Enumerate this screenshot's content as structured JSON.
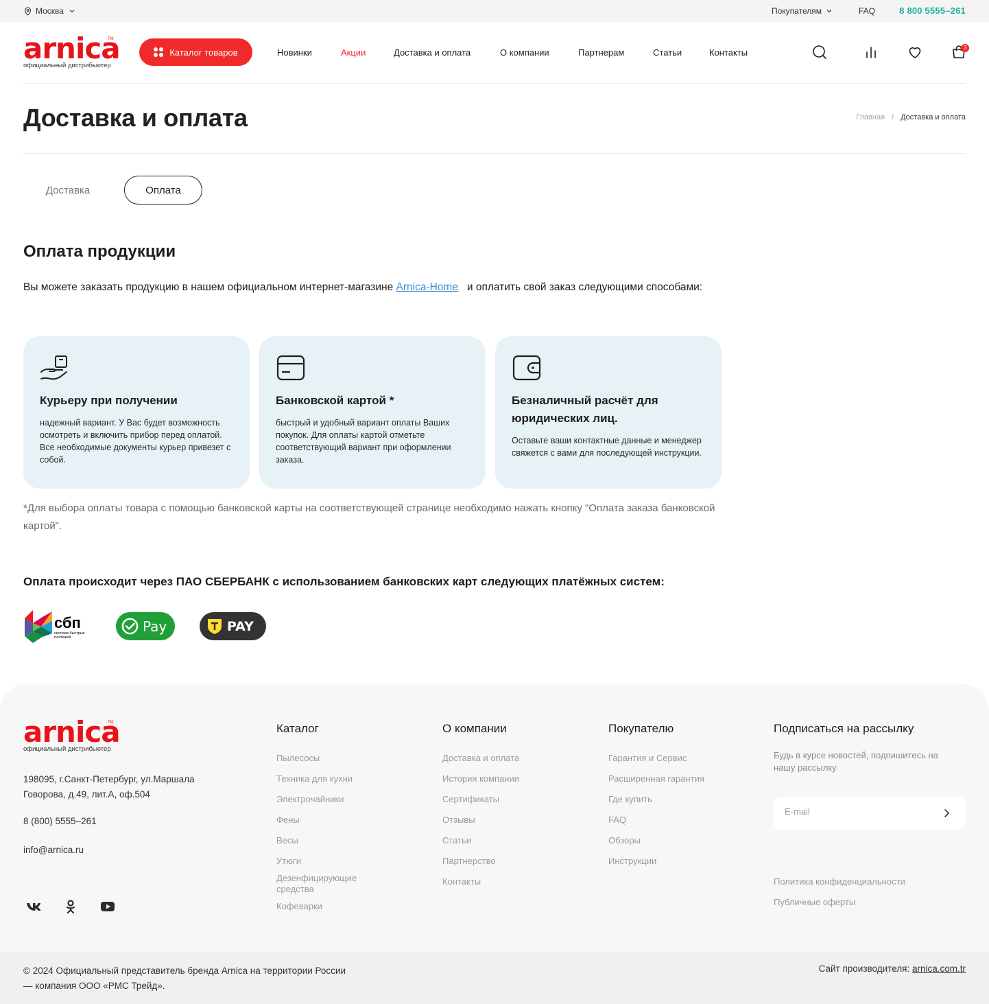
{
  "topbar": {
    "city": "Москва",
    "buyers": "Покупателям",
    "faq": "FAQ",
    "phone": "8 800 5555–261"
  },
  "logo": {
    "word": "arnica",
    "tagline": "официальный дистрибьютер"
  },
  "header": {
    "catalog_button": "Каталог товаров",
    "nav": [
      "Новинки",
      "Акции",
      "Доставка и оплата",
      "О компании",
      "Партнерам",
      "Статьи",
      "Контакты"
    ],
    "cart_count": "3"
  },
  "page": {
    "title": "Доставка и оплата",
    "breadcrumb": {
      "home": "Главная",
      "separator": "/",
      "current": "Доставка и оплата"
    },
    "tabs": {
      "delivery": "Доставка",
      "payment": "Оплата"
    },
    "section_title": "Оплата продукции",
    "intro_before": "Вы можете заказать продукцию в нашем официальном интернет-магазине ",
    "intro_link": "Arnica-Home",
    "intro_after": "   и оплатить свой заказ следующими способами:",
    "cards": [
      {
        "title": "Курьеру при получении",
        "text": "надежный вариант. У Вас будет возможность осмотреть и включить прибор перед оплатой. Все необходимые документы курьер привезет с собой."
      },
      {
        "title": "Банковской картой *",
        "text": "быстрый и удобный вариант оплаты Ваших покупок. Для оплаты картой отметьте соответствующий вариант при оформлении заказа."
      },
      {
        "title": "Безналичный расчёт для юридических лиц.",
        "text": "Оставьте ваши контактные данные и менеджер свяжется с вами для последующей инструкции."
      }
    ],
    "footnote": "*Для выбора оплаты товара с помощью банковской карты на соответствующей странице необходимо нажать кнопку \"Оплата заказа банковской картой\".",
    "sber_text": "Оплата происходит через ПАО СБЕРБАНК с использованием банковских карт следующих платёжных систем:",
    "pay_systems": {
      "sbp": "сбп",
      "sbp_sub": "система быстрых платежей",
      "pay": "Pay",
      "tpay": "PAY"
    }
  },
  "footer": {
    "address": "198095, г.Санкт-Петербург, ул.Маршала Говорова, д.49, лит.А, оф.504",
    "phone": "8 (800) 5555–261",
    "email": "info@arnica.ru",
    "catalog": {
      "title": "Каталог",
      "links": [
        "Пылесосы",
        "Техника для кухни",
        "Электрочайники",
        "Фены",
        "Весы",
        "Утюги",
        "Дезенфицирующие средства",
        "Кофеварки"
      ]
    },
    "company": {
      "title": "О компании",
      "links": [
        "Доставка и оплата",
        "История компании",
        "Сертификаты",
        "Отзывы",
        "Статьи",
        "Партнерство",
        "Контакты"
      ]
    },
    "buyer": {
      "title": "Покупателю",
      "links": [
        "Гарантия и Сервис",
        "Расширенная гарантия",
        "Где купить",
        "FAQ",
        "Обзоры",
        "Инструкции"
      ]
    },
    "subscribe": {
      "title": "Подписаться на рассылку",
      "text": "Будь в курсе новостей, подпишитесь на нашу рассылку",
      "placeholder": "E-mail"
    },
    "legal": [
      "Политика конфиденциальности",
      "Публичные оферты"
    ],
    "copyright": "© 2024 Официальный представитель бренда Arnica на территории России — компания ООО «РМС Трейд».",
    "maker_label": "Сайт производителя: ",
    "maker_link": "arnica.com.tr"
  }
}
